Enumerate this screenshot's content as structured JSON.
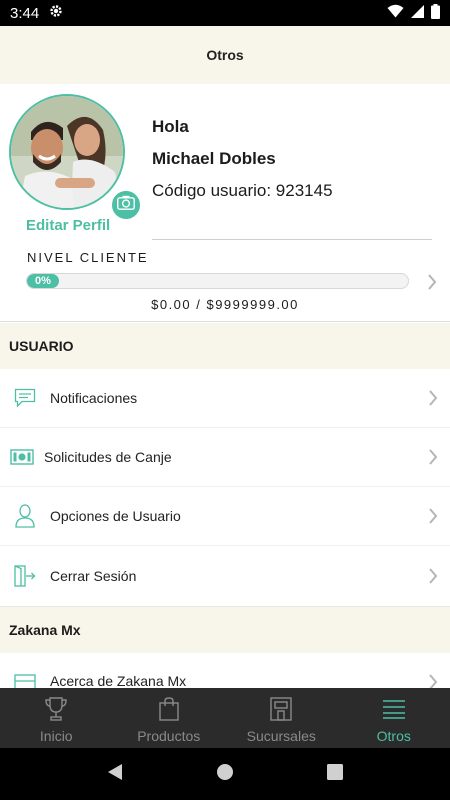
{
  "status_bar": {
    "time": "3:44"
  },
  "app_bar": {
    "title": "Otros"
  },
  "profile": {
    "greeting": "Hola",
    "name": "Michael Dobles",
    "user_code": "Código usuario: 923145",
    "edit_label": "Editar Perfil",
    "level_label": "NIVEL CLIENTE",
    "progress_text": "0%",
    "progress_value": 0,
    "amount_text": "$0.00 / $9999999.00"
  },
  "sections": {
    "usuario": {
      "title": "USUARIO",
      "items": [
        {
          "label": "Notificaciones",
          "icon": "chat-bubble-icon"
        },
        {
          "label": "Solicitudes de Canje",
          "icon": "money-bill-icon"
        },
        {
          "label": "Opciones de Usuario",
          "icon": "user-icon"
        },
        {
          "label": "Cerrar Sesión",
          "icon": "logout-door-icon"
        }
      ]
    },
    "zakana": {
      "title": "Zakana Mx",
      "items": [
        {
          "label": "Acerca de Zakana Mx",
          "icon": "store-icon"
        }
      ]
    }
  },
  "bottom_nav": {
    "items": [
      {
        "label": "Inicio",
        "icon": "trophy-icon",
        "active": false
      },
      {
        "label": "Productos",
        "icon": "shopping-bag-icon",
        "active": false
      },
      {
        "label": "Sucursales",
        "icon": "store-icon",
        "active": false
      },
      {
        "label": "Otros",
        "icon": "menu-lines-icon",
        "active": true
      }
    ]
  },
  "colors": {
    "accent": "#4cbfa4",
    "header_bg": "#f8f6ea",
    "nav_bg": "#2b2b2b",
    "nav_inactive": "#8a8a8a"
  }
}
